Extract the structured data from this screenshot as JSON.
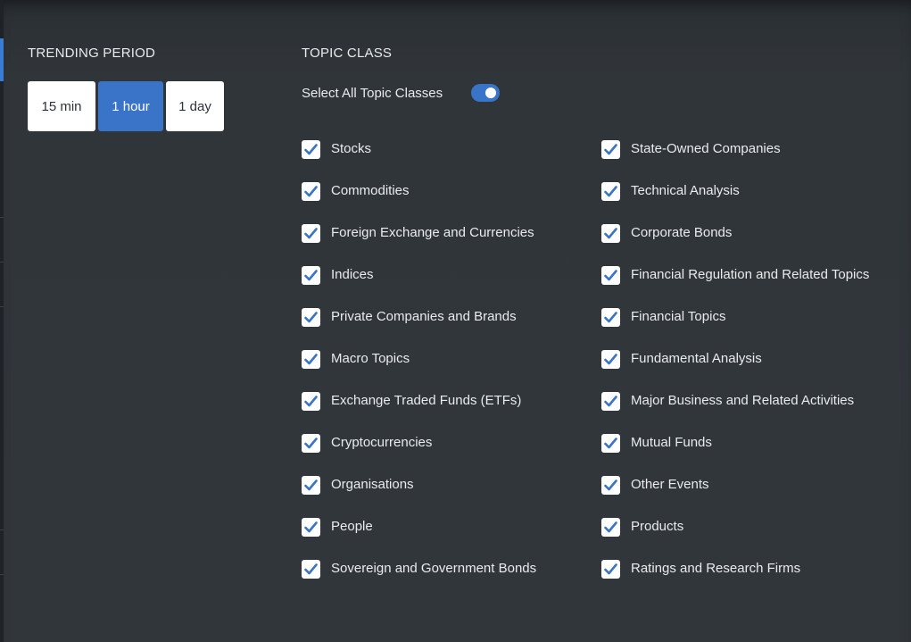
{
  "trending": {
    "title": "TRENDING PERIOD",
    "options": [
      "15 min",
      "1 hour",
      "1 day"
    ],
    "selected": "1 hour"
  },
  "topics": {
    "title": "TOPIC CLASS",
    "select_all_label": "Select All Topic Classes",
    "select_all_on": true,
    "left": [
      "Stocks",
      "Commodities",
      "Foreign Exchange and Currencies",
      "Indices",
      "Private Companies and Brands",
      "Macro Topics",
      "Exchange Traded Funds (ETFs)",
      "Cryptocurrencies",
      "Organisations",
      "People",
      "Sovereign and Government Bonds"
    ],
    "right": [
      "State-Owned Companies",
      "Technical Analysis",
      "Corporate Bonds",
      "Financial Regulation and Related Topics",
      "Financial Topics",
      "Fundamental Analysis",
      "Major Business and Related Activities",
      "Mutual Funds",
      "Other Events",
      "Products",
      "Ratings and Research Firms"
    ],
    "all_checked": true
  },
  "colors": {
    "background": "#31363b",
    "accent": "#3a74c8",
    "check": "#3a74c8",
    "text": "#e9ebed"
  },
  "icons": {
    "checkbox": "checkmark-icon",
    "toggle": "toggle-switch"
  }
}
